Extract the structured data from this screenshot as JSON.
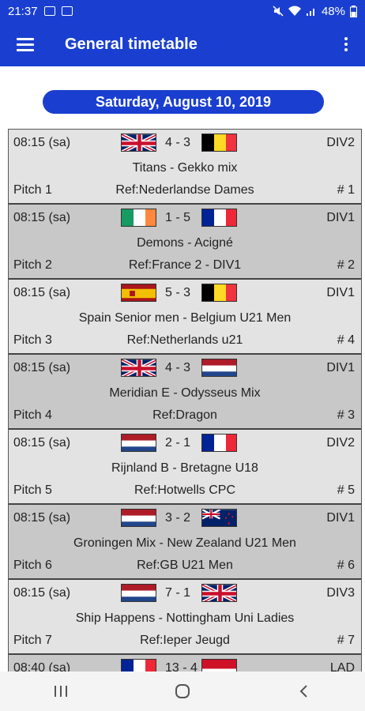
{
  "status": {
    "time": "21:37",
    "battery": "48%"
  },
  "app_bar": {
    "title": "General timetable",
    "menu_icon": "hamburger-menu-icon",
    "more_icon": "more-vertical-icon"
  },
  "date_label": "Saturday, August 10, 2019",
  "matches": [
    {
      "time": "08:15 (sa)",
      "score": "4 - 3",
      "division": "DIV2",
      "teams": "Titans - Gekko mix",
      "pitch": "Pitch 1",
      "ref": "Ref:Nederlandse Dames",
      "number": "# 1",
      "flag1": "gb",
      "flag2": "be"
    },
    {
      "time": "08:15 (sa)",
      "score": "1 - 5",
      "division": "DIV1",
      "teams": "Demons - Acigné",
      "pitch": "Pitch 2",
      "ref": "Ref:France 2 - DIV1",
      "number": "# 2",
      "flag1": "ie",
      "flag2": "fr"
    },
    {
      "time": "08:15 (sa)",
      "score": "5 - 3",
      "division": "DIV1",
      "teams": "Spain Senior men - Belgium U21 Men",
      "pitch": "Pitch 3",
      "ref": "Ref:Netherlands u21",
      "number": "# 4",
      "flag1": "es",
      "flag2": "be"
    },
    {
      "time": "08:15 (sa)",
      "score": "4 - 3",
      "division": "DIV1",
      "teams": "Meridian E - Odysseus Mix",
      "pitch": "Pitch 4",
      "ref": "Ref:Dragon",
      "number": "# 3",
      "flag1": "gb",
      "flag2": "nl"
    },
    {
      "time": "08:15 (sa)",
      "score": "2 - 1",
      "division": "DIV2",
      "teams": "Rijnland B - Bretagne U18",
      "pitch": "Pitch 5",
      "ref": "Ref:Hotwells CPC",
      "number": "# 5",
      "flag1": "nl",
      "flag2": "fr"
    },
    {
      "time": "08:15 (sa)",
      "score": "3 - 2",
      "division": "DIV1",
      "teams": "Groningen Mix - New Zealand U21 Men",
      "pitch": "Pitch 6",
      "ref": "Ref:GB U21 Men",
      "number": "# 6",
      "flag1": "nl",
      "flag2": "nz"
    },
    {
      "time": "08:15 (sa)",
      "score": "7 - 1",
      "division": "DIV3",
      "teams": "Ship Happens - Nottingham Uni Ladies",
      "pitch": "Pitch 7",
      "ref": "Ref:Ieper Jeugd",
      "number": "# 7",
      "flag1": "nl",
      "flag2": "gb"
    },
    {
      "time": "08:40 (sa)",
      "score": "13 - 4",
      "division": "LAD",
      "teams": "",
      "pitch": "",
      "ref": "",
      "number": "",
      "flag1": "fr",
      "flag2": "id"
    }
  ]
}
